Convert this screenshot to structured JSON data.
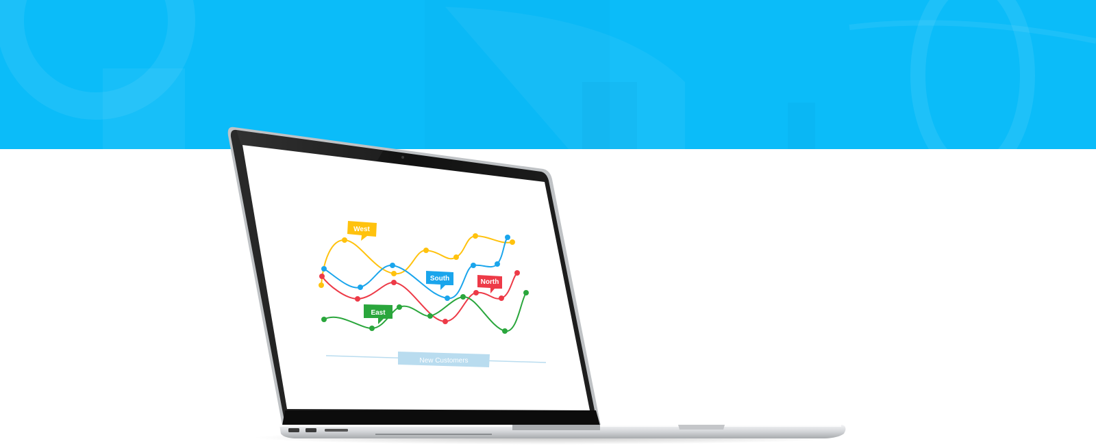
{
  "colors": {
    "hero_blue": "#0bbcf9",
    "background": "#ffffff",
    "bezel": "#141414",
    "aluminum": "#d8dadd",
    "west": "#ffc20e",
    "south": "#1aa5ec",
    "north": "#ed3a47",
    "east": "#2aa63c",
    "caption_bg": "#b9dcef"
  },
  "screen_chart": {
    "caption": "New Customers",
    "tags": {
      "west": "West",
      "south": "South",
      "north": "North",
      "east": "East"
    }
  },
  "chart_data": {
    "type": "line",
    "title": "",
    "xlabel": "New Customers",
    "ylabel": "",
    "legend": [
      "West",
      "South",
      "North",
      "East"
    ],
    "series": [
      {
        "name": "West",
        "color": "#ffc20e",
        "values": [
          2,
          9,
          3,
          7,
          6,
          9,
          7
        ]
      },
      {
        "name": "South",
        "color": "#1aa5ec",
        "values": [
          5,
          2,
          6,
          4,
          1,
          7,
          10
        ]
      },
      {
        "name": "North",
        "color": "#ed3a47",
        "values": [
          4,
          1,
          3,
          0,
          3,
          6,
          4
        ]
      },
      {
        "name": "East",
        "color": "#2aa63c",
        "values": [
          1,
          0,
          3,
          2,
          4,
          0,
          4
        ]
      }
    ]
  }
}
